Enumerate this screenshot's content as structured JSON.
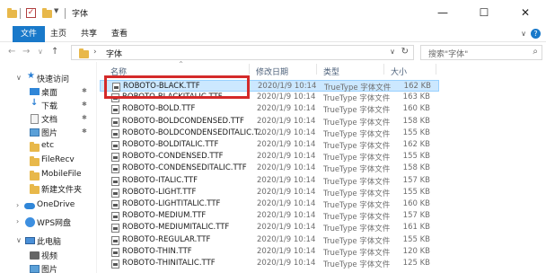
{
  "titlebar": {
    "title": "字体",
    "check_mark": "✓",
    "minimize": "—",
    "maximize": "☐",
    "close": "✕"
  },
  "ribbon": {
    "tabs": [
      "文件",
      "主页",
      "共享",
      "查看"
    ],
    "help": "?"
  },
  "address": {
    "back": "←",
    "forward": "→",
    "dropdown": "∨",
    "up": "↑",
    "separator": "›",
    "crumb": "字体",
    "dropdown_arrow": "∨",
    "refresh": "↻",
    "search_placeholder": "搜索\"字体\""
  },
  "nav": {
    "items": [
      {
        "label": "快速访问",
        "icon": "star-icon",
        "pinned": false,
        "expand": "∨"
      },
      {
        "label": "桌面",
        "icon": "desktop-icon",
        "pinned": true
      },
      {
        "label": "下载",
        "icon": "download-icon",
        "pinned": true
      },
      {
        "label": "文档",
        "icon": "document-icon",
        "pinned": true
      },
      {
        "label": "图片",
        "icon": "picture-icon",
        "pinned": true
      },
      {
        "label": "etc",
        "icon": "folder-icon",
        "pinned": false
      },
      {
        "label": "FileRecv",
        "icon": "folder-icon",
        "pinned": false
      },
      {
        "label": "MobileFile",
        "icon": "folder-icon",
        "pinned": false
      },
      {
        "label": "新建文件夹",
        "icon": "folder-icon",
        "pinned": false
      },
      {
        "label": "OneDrive",
        "icon": "cloud-icon",
        "pinned": false,
        "expand": "›"
      },
      {
        "label": "WPS网盘",
        "icon": "wps-cloud-icon",
        "pinned": false,
        "expand": "›"
      },
      {
        "label": "此电脑",
        "icon": "computer-icon",
        "pinned": false,
        "expand": "∨"
      },
      {
        "label": "视频",
        "icon": "video-icon",
        "pinned": false
      }
    ],
    "pin_glyph": "✱"
  },
  "columns": {
    "name": "名称",
    "date": "修改日期",
    "type": "类型",
    "size": "大小",
    "sort_glyph": "^"
  },
  "files": [
    {
      "name": "ROBOTO-BLACK.TTF",
      "date": "2020/1/9 10:14",
      "type": "TrueType 字体文件",
      "size": "162 KB",
      "selected": true
    },
    {
      "name": "ROBOTO-BLACKITALIC.TTF",
      "date": "2020/1/9 10:14",
      "type": "TrueType 字体文件",
      "size": "163 KB",
      "selected": false
    },
    {
      "name": "ROBOTO-BOLD.TTF",
      "date": "2020/1/9 10:14",
      "type": "TrueType 字体文件",
      "size": "160 KB",
      "selected": false
    },
    {
      "name": "ROBOTO-BOLDCONDENSED.TTF",
      "date": "2020/1/9 10:14",
      "type": "TrueType 字体文件",
      "size": "158 KB",
      "selected": false
    },
    {
      "name": "ROBOTO-BOLDCONDENSEDITALIC.T...",
      "date": "2020/1/9 10:14",
      "type": "TrueType 字体文件",
      "size": "155 KB",
      "selected": false
    },
    {
      "name": "ROBOTO-BOLDITALIC.TTF",
      "date": "2020/1/9 10:14",
      "type": "TrueType 字体文件",
      "size": "162 KB",
      "selected": false
    },
    {
      "name": "ROBOTO-CONDENSED.TTF",
      "date": "2020/1/9 10:14",
      "type": "TrueType 字体文件",
      "size": "155 KB",
      "selected": false
    },
    {
      "name": "ROBOTO-CONDENSEDITALIC.TTF",
      "date": "2020/1/9 10:14",
      "type": "TrueType 字体文件",
      "size": "158 KB",
      "selected": false
    },
    {
      "name": "ROBOTO-ITALIC.TTF",
      "date": "2020/1/9 10:14",
      "type": "TrueType 字体文件",
      "size": "157 KB",
      "selected": false
    },
    {
      "name": "ROBOTO-LIGHT.TTF",
      "date": "2020/1/9 10:14",
      "type": "TrueType 字体文件",
      "size": "155 KB",
      "selected": false
    },
    {
      "name": "ROBOTO-LIGHTITALIC.TTF",
      "date": "2020/1/9 10:14",
      "type": "TrueType 字体文件",
      "size": "160 KB",
      "selected": false
    },
    {
      "name": "ROBOTO-MEDIUM.TTF",
      "date": "2020/1/9 10:14",
      "type": "TrueType 字体文件",
      "size": "157 KB",
      "selected": false
    },
    {
      "name": "ROBOTO-MEDIUMITALIC.TTF",
      "date": "2020/1/9 10:14",
      "type": "TrueType 字体文件",
      "size": "161 KB",
      "selected": false
    },
    {
      "name": "ROBOTO-REGULAR.TTF",
      "date": "2020/1/9 10:14",
      "type": "TrueType 字体文件",
      "size": "155 KB",
      "selected": false
    },
    {
      "name": "ROBOTO-THIN.TTF",
      "date": "2020/1/9 10:14",
      "type": "TrueType 字体文件",
      "size": "120 KB",
      "selected": false
    },
    {
      "name": "ROBOTO-THINITALIC.TTF",
      "date": "2020/1/9 10:14",
      "type": "TrueType 字体文件",
      "size": "125 KB",
      "selected": false
    }
  ],
  "colors": {
    "accent": "#1979ca",
    "selection_bg": "#cce8ff",
    "highlight_box": "#d42a2a"
  }
}
